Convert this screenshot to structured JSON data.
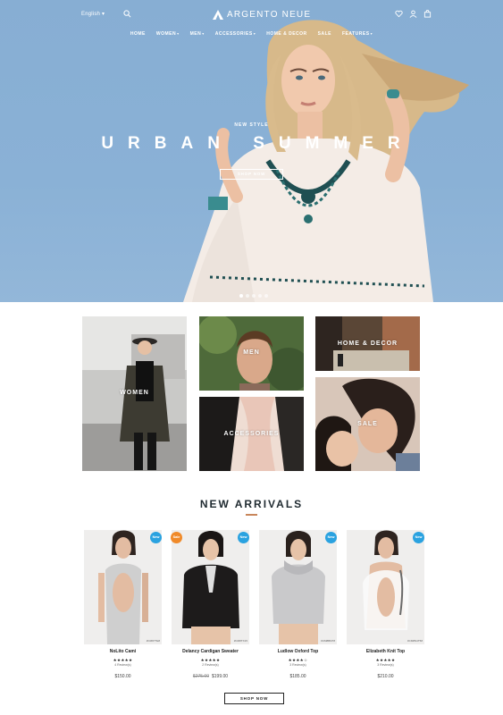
{
  "header": {
    "language": "English",
    "brand": "ARGENTO NEUE",
    "nav": [
      {
        "label": "HOME",
        "dropdown": false
      },
      {
        "label": "WOMEN",
        "dropdown": true
      },
      {
        "label": "MEN",
        "dropdown": true
      },
      {
        "label": "ACCESSORIES",
        "dropdown": true
      },
      {
        "label": "HOME & DECOR",
        "dropdown": false
      },
      {
        "label": "SALE",
        "dropdown": false
      },
      {
        "label": "FEATURES",
        "dropdown": true
      }
    ]
  },
  "hero": {
    "kicker": "NEW STYLE",
    "title": "URBAN SUMMER",
    "button": "SHOP NOW",
    "slides": 5,
    "active_slide": 1
  },
  "categories": {
    "women": "WOMEN",
    "men": "MEN",
    "home_decor": "HOME & DECOR",
    "accessories": "ACCESSORIES",
    "sale": "SALE"
  },
  "new_arrivals": {
    "title": "NEW ARRIVALS",
    "products": [
      {
        "name": "NoLito Cami",
        "badge": "New",
        "badge_type": "new",
        "sku": "#CM87TE8",
        "stars": "★★★★★",
        "reviews": "4 Review(s)",
        "old_price": "",
        "price": "$150.00"
      },
      {
        "name": "Delancy Cardigan Sweater",
        "badge": "Sale",
        "badge_type": "sale",
        "badge2": "New",
        "sku": "#CM8TX15",
        "stars": "★★★★★",
        "reviews": "2 Review(s)",
        "old_price": "$275.00",
        "price": "$199.00"
      },
      {
        "name": "Ludlow Oxford Top",
        "badge": "New",
        "badge_type": "new",
        "sku": "#CM8BM78",
        "stars": "★★★★☆",
        "reviews": "3 Review(s)",
        "old_price": "",
        "price": "$185.00"
      },
      {
        "name": "Elizabeth Knit Top",
        "badge": "New",
        "badge_type": "new",
        "sku": "#CM8N4T58",
        "stars": "★★★★★",
        "reviews": "3 Review(s)",
        "old_price": "",
        "price": "$210.00"
      }
    ],
    "shop_button": "SHOP NOW"
  },
  "colors": {
    "hero_sky": "#8ab1d6",
    "accent": "#c8865b",
    "badge_new": "#2aa2e0",
    "badge_sale": "#f08a2a",
    "heading": "#1f2a30"
  },
  "icons": [
    "search-icon",
    "logo-mark-icon",
    "heart-icon",
    "user-icon",
    "cart-icon"
  ]
}
